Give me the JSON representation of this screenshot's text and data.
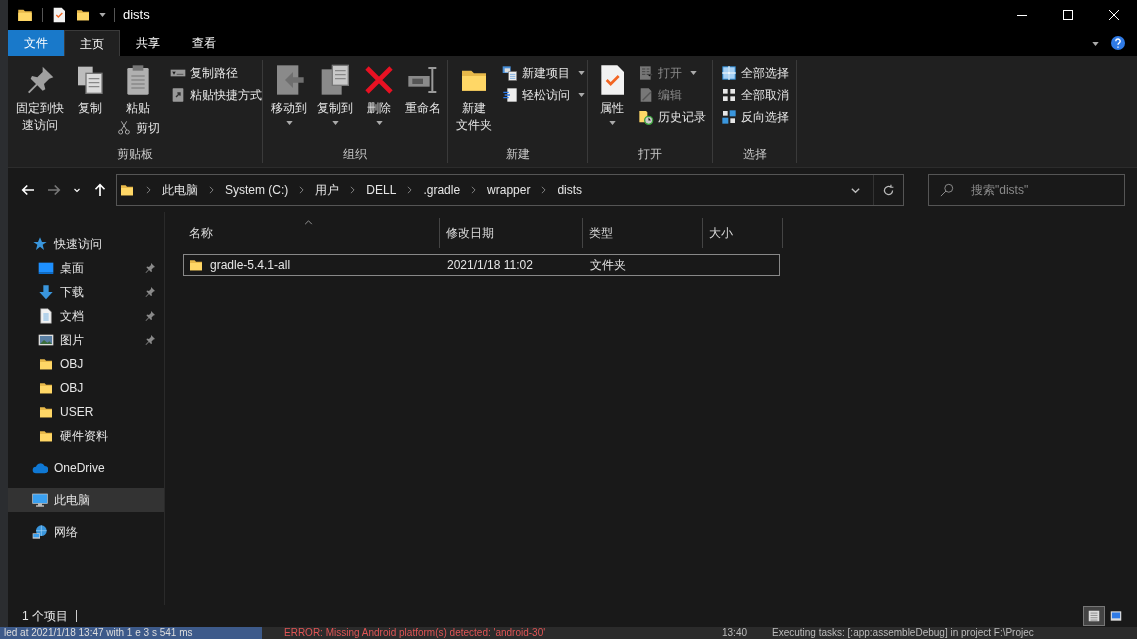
{
  "window": {
    "title": "dists"
  },
  "ribbon_tabs": [
    {
      "label": "文件",
      "kind": "file",
      "selected": false
    },
    {
      "label": "主页",
      "kind": "tab",
      "selected": true
    },
    {
      "label": "共享",
      "kind": "tab",
      "selected": false
    },
    {
      "label": "查看",
      "kind": "tab",
      "selected": false
    }
  ],
  "ribbon_groups": [
    {
      "label": "剪贴板",
      "columns": [
        {
          "kind": "large",
          "buttons": [
            {
              "kind": "pin",
              "lines": [
                "固定到快",
                "速访问"
              ],
              "dropdown": false,
              "disabled": false
            }
          ]
        },
        {
          "kind": "large",
          "buttons": [
            {
              "kind": "copy",
              "lines": [
                "复制"
              ],
              "dropdown": false,
              "disabled": false
            }
          ]
        },
        {
          "kind": "mixed",
          "buttons": [
            {
              "kind": "paste",
              "lines": [
                "粘贴"
              ],
              "dropdown": false,
              "disabled": false
            },
            {
              "kind": "cut",
              "lines": [
                "剪切"
              ],
              "dropdown": false,
              "disabled": false
            }
          ]
        },
        {
          "kind": "small",
          "buttons": [
            {
              "kind": "copy-path",
              "lines": [
                "复制路径"
              ],
              "dropdown": false,
              "disabled": false
            },
            {
              "kind": "paste-shortcut",
              "lines": [
                "粘贴快捷方式"
              ],
              "dropdown": false,
              "disabled": false
            }
          ]
        }
      ]
    },
    {
      "label": "组织",
      "columns": [
        {
          "kind": "large",
          "buttons": [
            {
              "kind": "move-to",
              "lines": [
                "移动到"
              ],
              "dropdown": true,
              "disabled": false
            }
          ]
        },
        {
          "kind": "large",
          "buttons": [
            {
              "kind": "copy-to",
              "lines": [
                "复制到"
              ],
              "dropdown": true,
              "disabled": false
            }
          ]
        },
        {
          "kind": "large",
          "buttons": [
            {
              "kind": "delete",
              "lines": [
                "删除"
              ],
              "dropdown": true,
              "disabled": false
            }
          ]
        },
        {
          "kind": "large",
          "buttons": [
            {
              "kind": "rename",
              "lines": [
                "重命名"
              ],
              "dropdown": false,
              "disabled": false
            }
          ]
        }
      ]
    },
    {
      "label": "新建",
      "columns": [
        {
          "kind": "large",
          "buttons": [
            {
              "kind": "new-folder",
              "lines": [
                "新建",
                "文件夹"
              ],
              "dropdown": false,
              "disabled": false
            }
          ]
        },
        {
          "kind": "small",
          "buttons": [
            {
              "kind": "new-item",
              "lines": [
                "新建项目"
              ],
              "dropdown": true,
              "disabled": false
            },
            {
              "kind": "easy-access",
              "lines": [
                "轻松访问"
              ],
              "dropdown": true,
              "disabled": false
            }
          ]
        }
      ]
    },
    {
      "label": "打开",
      "columns": [
        {
          "kind": "large",
          "buttons": [
            {
              "kind": "properties",
              "lines": [
                "属性"
              ],
              "dropdown": true,
              "disabled": false
            }
          ]
        },
        {
          "kind": "small",
          "buttons": [
            {
              "kind": "open",
              "lines": [
                "打开"
              ],
              "dropdown": true,
              "disabled": true
            },
            {
              "kind": "edit",
              "lines": [
                "编辑"
              ],
              "dropdown": false,
              "disabled": true
            },
            {
              "kind": "history",
              "lines": [
                "历史记录"
              ],
              "dropdown": false,
              "disabled": false
            }
          ]
        }
      ]
    },
    {
      "label": "选择",
      "columns": [
        {
          "kind": "small",
          "buttons": [
            {
              "kind": "select-all",
              "lines": [
                "全部选择"
              ],
              "dropdown": false,
              "disabled": false
            },
            {
              "kind": "select-none",
              "lines": [
                "全部取消"
              ],
              "dropdown": false,
              "disabled": false
            },
            {
              "kind": "invert-selection",
              "lines": [
                "反向选择"
              ],
              "dropdown": false,
              "disabled": false
            }
          ]
        }
      ]
    }
  ],
  "nav_buttons": [
    {
      "kind": "back",
      "disabled": false
    },
    {
      "kind": "forward",
      "disabled": true
    },
    {
      "kind": "recent",
      "disabled": false
    },
    {
      "kind": "up",
      "disabled": false
    }
  ],
  "address_path": [
    "此电脑",
    "System (C:)",
    "用户",
    "DELL",
    ".gradle",
    "wrapper",
    "dists"
  ],
  "search": {
    "placeholder": "搜索\"dists\""
  },
  "sidebar": [
    {
      "label": "快速访问",
      "kind": "star",
      "selected": false,
      "children": [
        {
          "label": "桌面",
          "kind": "desktop",
          "pinned": true,
          "selected": false
        },
        {
          "label": "下载",
          "kind": "download",
          "pinned": true,
          "selected": false
        },
        {
          "label": "文档",
          "kind": "document",
          "pinned": true,
          "selected": false
        },
        {
          "label": "图片",
          "kind": "pictures",
          "pinned": true,
          "selected": false
        },
        {
          "label": "OBJ",
          "kind": "folder",
          "pinned": false,
          "selected": false
        },
        {
          "label": "OBJ",
          "kind": "folder",
          "pinned": false,
          "selected": false
        },
        {
          "label": "USER",
          "kind": "folder",
          "pinned": false,
          "selected": false
        },
        {
          "label": "硬件资料",
          "kind": "folder",
          "pinned": false,
          "selected": false
        }
      ]
    },
    {
      "label": "OneDrive",
      "kind": "cloud",
      "selected": false
    },
    {
      "label": "此电脑",
      "kind": "computer",
      "selected": true
    },
    {
      "label": "网络",
      "kind": "network",
      "selected": false
    }
  ],
  "table": {
    "columns": [
      {
        "label": "名称",
        "sorted": true
      },
      {
        "label": "修改日期",
        "sorted": false
      },
      {
        "label": "类型",
        "sorted": false
      },
      {
        "label": "大小",
        "sorted": false
      }
    ],
    "rows": [
      {
        "name": "gradle-5.4.1-all",
        "modified": "2021/1/18 11:02",
        "type": "文件夹",
        "selected": true
      }
    ]
  },
  "status_bar": {
    "text": "1 个项目",
    "views": [
      {
        "kind": "details",
        "selected": true
      },
      {
        "kind": "large-icons",
        "selected": false
      }
    ]
  },
  "background_window": {
    "texts": [
      {
        "kind": "status",
        "text": "led at 2021/1/18 13:47 with 1 e 3 s 541 ms"
      },
      {
        "kind": "error",
        "text": "ERROR: Missing Android platform(s) detected: 'android-30'"
      },
      {
        "kind": "time",
        "text": "13:40"
      },
      {
        "kind": "plain",
        "text": "Executing tasks: [:app:assembleDebug] in project F:\\Projec"
      }
    ]
  }
}
